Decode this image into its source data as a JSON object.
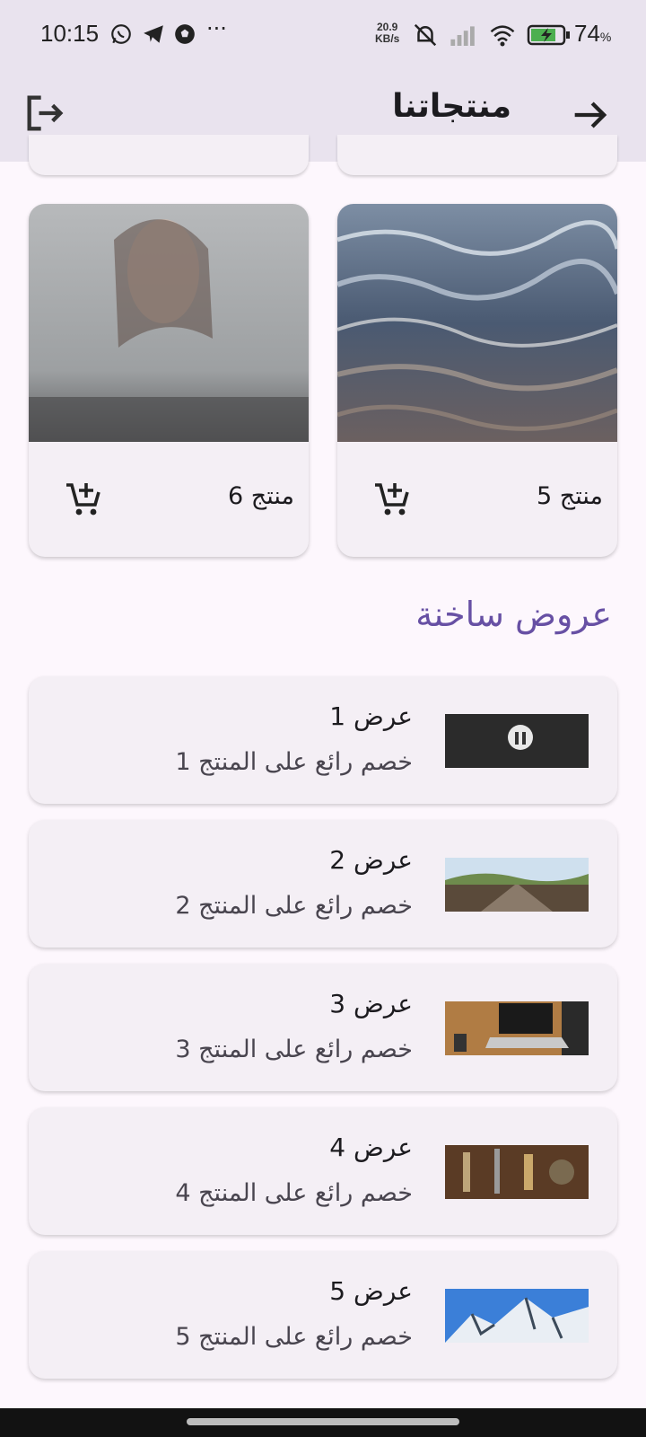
{
  "status_bar": {
    "time": "10:15",
    "speed_value": "20.9",
    "speed_unit": "KB/s",
    "battery": "74",
    "battery_unit": "%"
  },
  "app_bar": {
    "title": "منتجاتنا",
    "back_icon": "arrow-forward-icon",
    "logout_icon": "logout-icon"
  },
  "products": [
    {
      "name": "منتج 5",
      "image": "water-waves-photo"
    },
    {
      "name": "منتج 6",
      "image": "woman-behind-rainy-window-photo"
    }
  ],
  "offers_section": {
    "title": "عروض ساخنة",
    "items": [
      {
        "title": "عرض 1",
        "subtitle": "خصم رائع على المنتج 1",
        "image": "dark-tunnel-silhouettes-photo"
      },
      {
        "title": "عرض 2",
        "subtitle": "خصم رائع على المنتج 2",
        "image": "railway-bridge-photo"
      },
      {
        "title": "عرض 3",
        "subtitle": "خصم رائع على المنتج 3",
        "image": "laptop-typing-photo"
      },
      {
        "title": "عرض 4",
        "subtitle": "خصم رائع على المنتج 4",
        "image": "tools-on-wood-photo"
      },
      {
        "title": "عرض 5",
        "subtitle": "خصم رائع على المنتج 5",
        "image": "snowy-mountains-photo"
      }
    ]
  },
  "colors": {
    "accent": "#6750a4",
    "card": "#f4eff5",
    "background": "#fdf7fd",
    "appbar": "#e9e3ee"
  }
}
